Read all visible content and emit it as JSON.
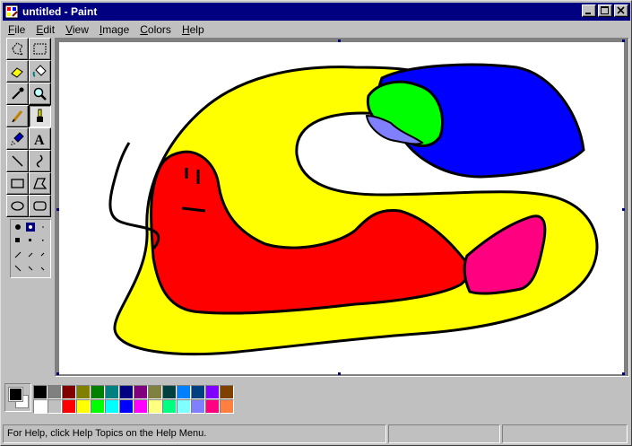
{
  "window": {
    "title": "untitled - Paint"
  },
  "menu": [
    {
      "label": "File",
      "accel": "F",
      "rest": "ile"
    },
    {
      "label": "Edit",
      "accel": "E",
      "rest": "dit"
    },
    {
      "label": "View",
      "accel": "V",
      "rest": "iew"
    },
    {
      "label": "Image",
      "accel": "I",
      "rest": "mage"
    },
    {
      "label": "Colors",
      "accel": "C",
      "rest": "olors"
    },
    {
      "label": "Help",
      "accel": "H",
      "rest": "elp"
    }
  ],
  "tools": [
    {
      "name": "free-form-select-icon"
    },
    {
      "name": "rectangle-select-icon"
    },
    {
      "name": "eraser-icon"
    },
    {
      "name": "fill-bucket-icon"
    },
    {
      "name": "pick-color-icon"
    },
    {
      "name": "magnifier-icon"
    },
    {
      "name": "pencil-icon"
    },
    {
      "name": "brush-icon",
      "active": true
    },
    {
      "name": "airbrush-icon"
    },
    {
      "name": "text-icon"
    },
    {
      "name": "line-icon"
    },
    {
      "name": "curve-icon"
    },
    {
      "name": "rectangle-icon"
    },
    {
      "name": "polygon-icon"
    },
    {
      "name": "ellipse-icon"
    },
    {
      "name": "rounded-rectangle-icon"
    }
  ],
  "palette": {
    "foreground": "#000000",
    "background": "#ffffff",
    "colors": [
      "#000000",
      "#808080",
      "#800000",
      "#808000",
      "#008000",
      "#008080",
      "#000080",
      "#800080",
      "#808040",
      "#004040",
      "#0080ff",
      "#004080",
      "#8000ff",
      "#804000",
      "#ffffff",
      "#c0c0c0",
      "#ff0000",
      "#ffff00",
      "#00ff00",
      "#00ffff",
      "#0000ff",
      "#ff00ff",
      "#ffff80",
      "#00ff80",
      "#80ffff",
      "#8080ff",
      "#ff0080",
      "#ff8040"
    ]
  },
  "status": {
    "help_text": "For Help, click Help Topics on the Help Menu."
  },
  "drawing": {
    "colors": {
      "yellow": "#ffff00",
      "blue": "#0000ff",
      "green": "#00ff00",
      "lavender": "#8080ff",
      "red": "#ff0000",
      "pink": "#ff0080",
      "outline": "#000000"
    }
  }
}
